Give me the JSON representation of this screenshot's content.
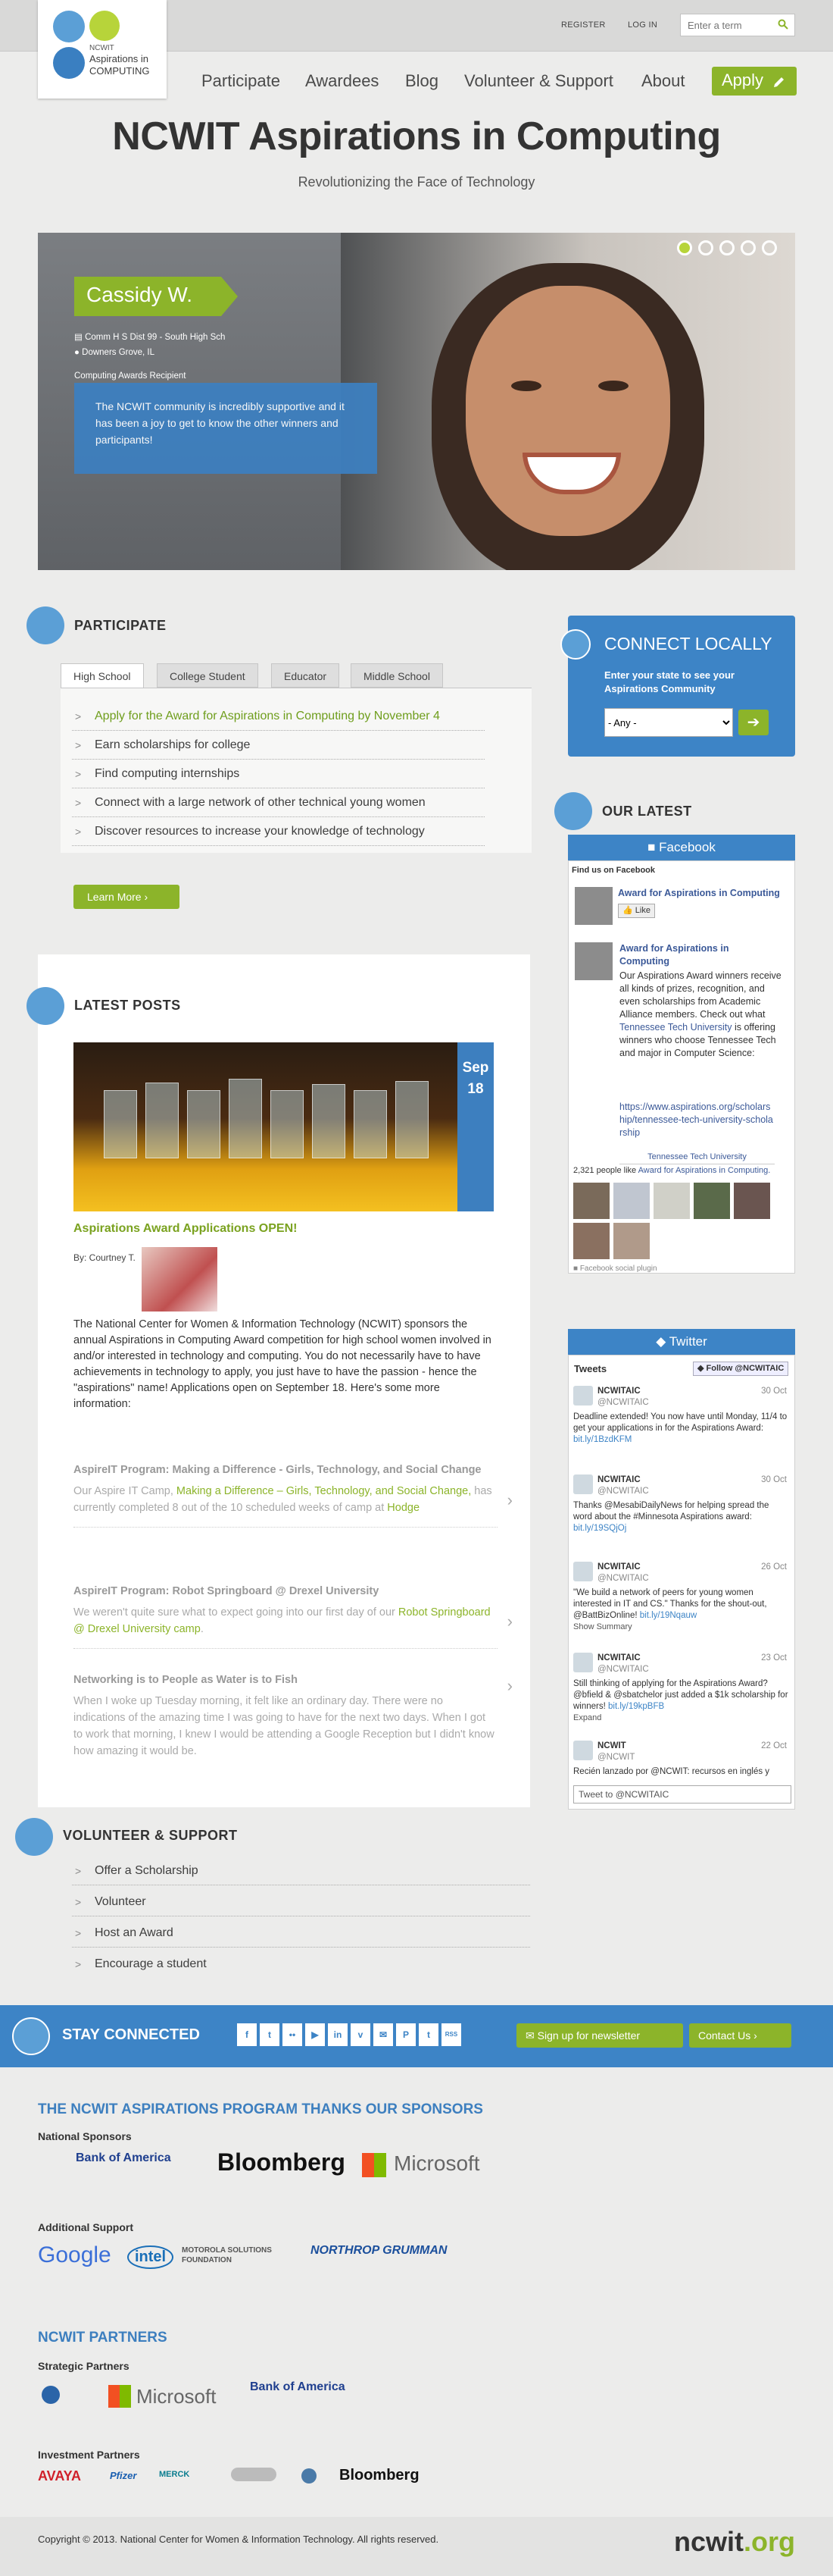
{
  "header": {
    "logo": {
      "line1": "NCWIT",
      "line2": "Aspirations in",
      "line3": "COMPUTING"
    },
    "utility": [
      "REGISTER",
      "LOG IN"
    ],
    "search_placeholder": "Enter a term",
    "nav": [
      "Participate",
      "Awardees",
      "Blog",
      "Volunteer & Support",
      "About"
    ],
    "apply_label": "Apply"
  },
  "hero": {
    "title": "NCWIT Aspirations in Computing",
    "subtitle": "Revolutionizing the Face of Technology",
    "slide": {
      "name": "Cassidy W.",
      "school": "Comm H S Dist 99 - South High Sch",
      "location": "Downers Grove, IL",
      "award": "Computing Awards Recipient",
      "quote": "The NCWIT community is incredibly supportive and it has been a joy to get to know the other winners and participants!"
    },
    "slide_count": 5,
    "active_slide": 1
  },
  "participate": {
    "title": "PARTICIPATE",
    "tabs": [
      "High School",
      "College Student",
      "Educator",
      "Middle School"
    ],
    "items": [
      "Apply for the Award for Aspirations in Computing by November 4",
      "Earn scholarships for college",
      "Find computing internships",
      "Connect with a large network of other technical young women",
      "Discover resources to increase your knowledge of technology"
    ],
    "button": "Learn More"
  },
  "connect": {
    "title": "CONNECT LOCALLY",
    "text": "Enter your state to see your Aspirations Community",
    "select_value": "- Any -",
    "go": "➔"
  },
  "latest": {
    "title": "OUR LATEST",
    "facebook": {
      "header": "Facebook",
      "find": "Find us on Facebook",
      "page_name": "Award for Aspirations in Computing",
      "like": "Like",
      "post_title": "Award for Aspirations in Computing",
      "post_body_1": "Our Aspirations Award winners receive all kinds of prizes, recognition, and even scholarships from Academic Alliance members. Check out what",
      "post_link": "Tennessee Tech University",
      "post_body_2": "is offering winners who choose Tennessee Tech and major in Computer Science:",
      "url": "https://www.aspirations.org/scholarship/tennessee-tech-university-scholarship",
      "caption": "Tennessee Tech University",
      "likes_prefix": "2,321 people like",
      "likes_link": "Award for Aspirations in Computing.",
      "plugin": "Facebook social plugin"
    },
    "twitter": {
      "header": "Twitter",
      "tweets_label": "Tweets",
      "follow": "Follow @NCWITAIC",
      "tweets": [
        {
          "name": "NCWITAIC",
          "handle": "@NCWITAIC",
          "date": "30 Oct",
          "text": "Deadline extended! You now have until Monday, 11/4 to get your applications in for the Aspirations Award:",
          "link": "bit.ly/1BzdKFM"
        },
        {
          "name": "NCWITAIC",
          "handle": "@NCWITAIC",
          "date": "30 Oct",
          "text": "Thanks @MesabiDailyNews for helping spread the word about the #Minnesota Aspirations award:",
          "link": "bit.ly/19SQjOj"
        },
        {
          "name": "NCWITAIC",
          "handle": "@NCWITAIC",
          "date": "26 Oct",
          "text": "\"We build a network of peers for young women interested in IT and CS.\" Thanks for the shout-out, @BattBizOnline!",
          "link": "bit.ly/19Nqauw",
          "extra": "Show Summary"
        },
        {
          "name": "NCWITAIC",
          "handle": "@NCWITAIC",
          "date": "23 Oct",
          "text": "Still thinking of applying for the Aspirations Award? @bfield & @sbatchelor just added a $1k scholarship for winners!",
          "link": "bit.ly/19kpBFB",
          "extra": "Expand"
        },
        {
          "name": "NCWIT",
          "handle": "@NCWIT",
          "date": "22 Oct",
          "text": "Recién lanzado por @NCWIT: recursos en inglés y",
          "link": ""
        }
      ],
      "compose": "Tweet to @NCWITAIC"
    }
  },
  "posts": {
    "title": "LATEST POSTS",
    "featured": {
      "month": "Sep",
      "day": "18",
      "title": "Aspirations Award Applications OPEN!",
      "by": "By: Courtney T.",
      "body": "The National Center for Women & Information Technology (NCWIT) sponsors the annual Aspirations in Computing Award competition for high school women involved in and/or interested in technology and computing. You do not necessarily have to have achievements in technology to apply, you just have to have the passion - hence the \"aspirations\" name! Applications open on September 18. Here's some more information:"
    },
    "more": [
      {
        "title": "AspireIT Program: Making a Difference - Girls, Technology, and Social Change",
        "t1": "Our Aspire IT Camp,",
        "link": "Making a Difference – Girls, Technology, and Social Change,",
        "t2": "has currently completed 8 out of the 10 scheduled weeks of camp at",
        "link2": "Hodge"
      },
      {
        "title": "AspireIT Program: Robot Springboard @ Drexel University",
        "t1": "We weren't quite sure what to expect going into our first day of our",
        "link": "Robot Springboard @ Drexel University camp",
        "t2": ".",
        "link2": ""
      },
      {
        "title": "Networking is to People as Water is to Fish",
        "t1": "When I woke up Tuesday morning, it felt like an ordinary day. There were no indications of the amazing time I was going to have for the next two days. When I got to work that morning, I knew I would be attending a Google Reception but I didn't know how amazing it would be.",
        "link": "",
        "t2": "",
        "link2": ""
      }
    ]
  },
  "volunteer": {
    "title": "VOLUNTEER & SUPPORT",
    "items": [
      "Offer a Scholarship",
      "Volunteer",
      "Host an Award",
      "Encourage a student"
    ]
  },
  "stay": {
    "label": "STAY CONNECTED",
    "icons": [
      "f",
      "t",
      "••",
      "▶",
      "in",
      "v",
      "✉",
      "P",
      "t",
      "RSS"
    ],
    "newsletter": "Sign up for newsletter",
    "contact": "Contact Us"
  },
  "sponsors": {
    "title": "THE NCWIT ASPIRATIONS PROGRAM THANKS OUR SPONSORS",
    "national_label": "National Sponsors",
    "national": [
      "Bank of America",
      "Bloomberg",
      "Microsoft"
    ],
    "additional_label": "Additional Support",
    "additional": [
      "Google",
      "intel",
      "MOTOROLA SOLUTIONS FOUNDATION",
      "NORTHROP GRUMMAN"
    ]
  },
  "partners": {
    "title": "NCWIT PARTNERS",
    "strategic_label": "Strategic Partners",
    "strategic": [
      "Microsoft",
      "Bank of America"
    ],
    "investment_label": "Investment Partners",
    "investment": [
      "AVAYA",
      "Pfizer",
      "MERCK",
      "Bloomberg"
    ]
  },
  "footer": {
    "copyright": "Copyright © 2013. National Center for Women & Information Technology. All rights reserved.",
    "brand_a": "ncwit",
    "brand_b": ".org"
  },
  "colors": {
    "green": "#8cb42a",
    "blue": "#3d84c6",
    "light_blue": "#5b9fd6"
  }
}
